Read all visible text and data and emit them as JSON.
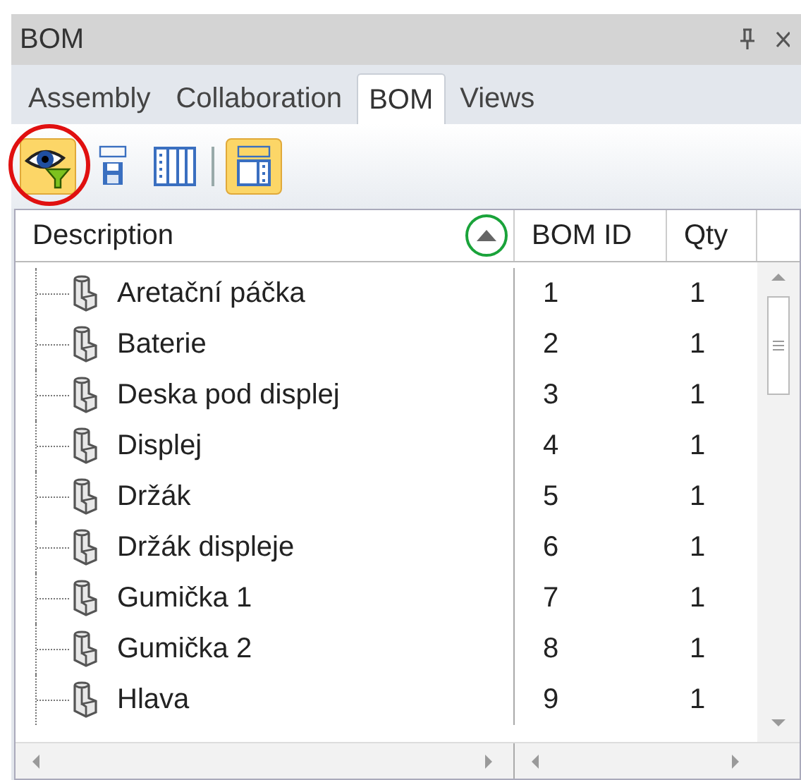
{
  "panel": {
    "title": "BOM"
  },
  "tabs": [
    {
      "label": "Assembly",
      "selected": false
    },
    {
      "label": "Collaboration",
      "selected": false
    },
    {
      "label": "BOM",
      "selected": true
    },
    {
      "label": "Views",
      "selected": false
    }
  ],
  "toolbar": [
    {
      "kind": "eye-filter",
      "selected": true,
      "highlighted": true
    },
    {
      "kind": "bom-save",
      "selected": false,
      "highlighted": false
    },
    {
      "kind": "columns",
      "selected": false,
      "highlighted": false
    },
    {
      "kind": "separator"
    },
    {
      "kind": "bom-view",
      "selected": true,
      "highlighted": false
    }
  ],
  "table": {
    "columns": [
      {
        "label": "Description",
        "sorted_ascending": true
      },
      {
        "label": "BOM ID"
      },
      {
        "label": "Qty"
      }
    ],
    "rows": [
      {
        "description": "Aretační páčka",
        "bom_id": "1",
        "qty": "1"
      },
      {
        "description": "Baterie",
        "bom_id": "2",
        "qty": "1"
      },
      {
        "description": "Deska pod displej",
        "bom_id": "3",
        "qty": "1"
      },
      {
        "description": "Displej",
        "bom_id": "4",
        "qty": "1"
      },
      {
        "description": "Držák",
        "bom_id": "5",
        "qty": "1"
      },
      {
        "description": "Držák displeje",
        "bom_id": "6",
        "qty": "1"
      },
      {
        "description": "Gumička 1",
        "bom_id": "7",
        "qty": "1"
      },
      {
        "description": "Gumička 2",
        "bom_id": "8",
        "qty": "1"
      },
      {
        "description": "Hlava",
        "bom_id": "9",
        "qty": "1"
      }
    ]
  }
}
